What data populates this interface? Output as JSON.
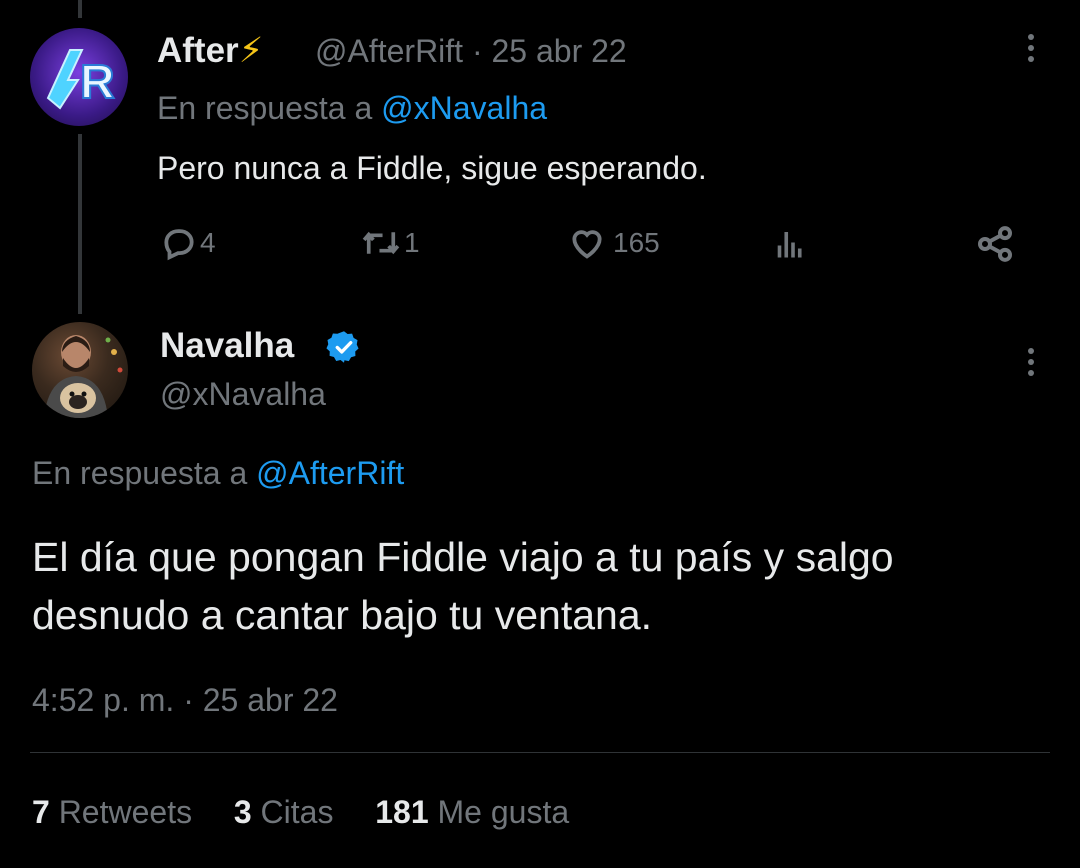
{
  "reply_tweet": {
    "display_name": "After",
    "name_emoji": "⚡",
    "meta": "@AfterRift · 25 abr 22",
    "reply_prefix": "En respuesta a",
    "reply_to": "@xNavalha",
    "text": "Pero nunca a Fiddle, sigue esperando.",
    "actions": {
      "replies": "4",
      "retweets": "1",
      "likes": "165"
    },
    "avatar_text": "R"
  },
  "main_tweet": {
    "display_name": "Navalha",
    "handle": "@xNavalha",
    "reply_prefix": "En respuesta a",
    "reply_to": "@AfterRift",
    "text_line1": "El día que pongan Fiddle viajo a tu país y salgo",
    "text_line2": "desnudo a cantar bajo tu ventana.",
    "timestamp": "4:52 p. m. · 25 abr 22",
    "stats": {
      "retweets_count": "7",
      "retweets_label": "Retweets",
      "quotes_count": "3",
      "quotes_label": "Citas",
      "likes_count": "181",
      "likes_label": "Me gusta"
    }
  },
  "colors": {
    "background": "#000000",
    "text": "#e7e9ea",
    "muted": "#71767b",
    "link": "#1d9bf0",
    "verified": "#1d9bf0"
  }
}
